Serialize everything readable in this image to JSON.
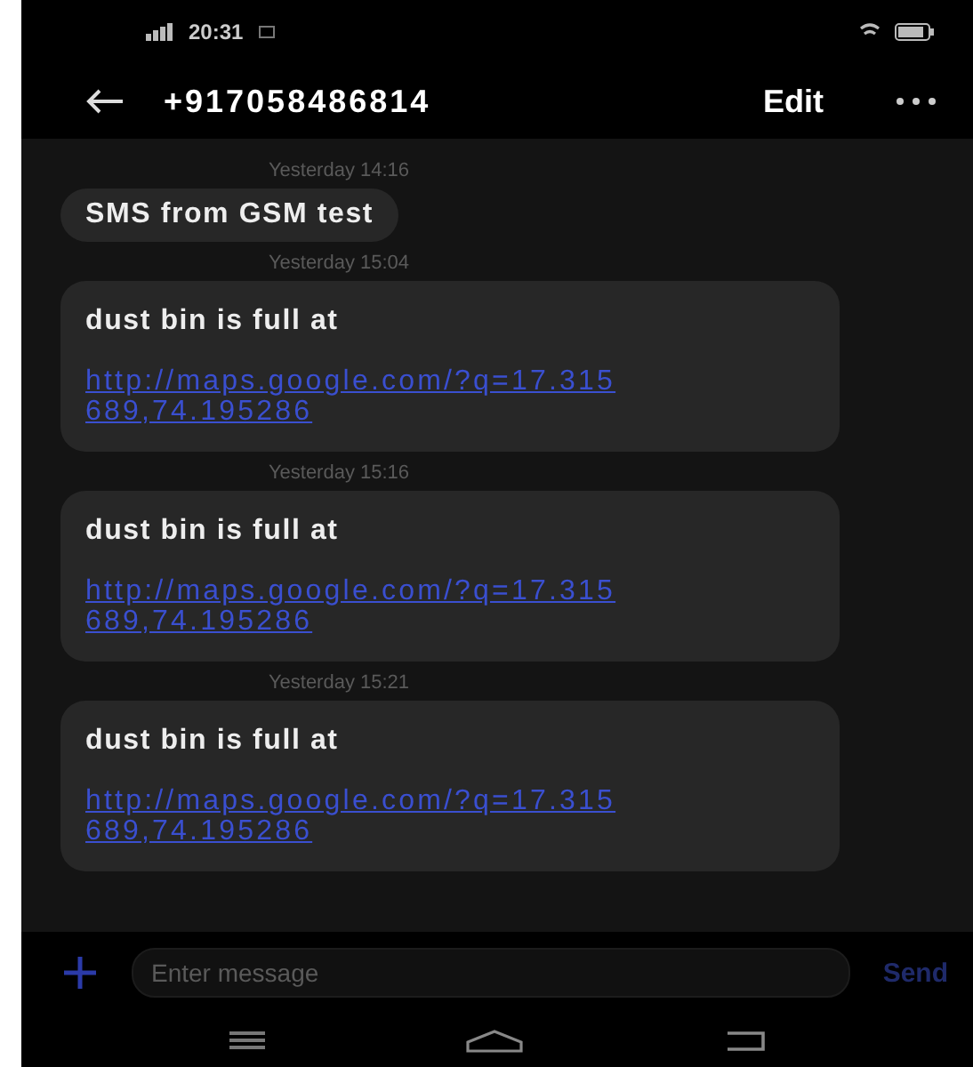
{
  "status_bar": {
    "time": "20:31"
  },
  "header": {
    "title": "+917058486814",
    "action": "Edit"
  },
  "messages": [
    {
      "timestamp": "Yesterday 14:16",
      "text": "SMS from GSM test"
    },
    {
      "timestamp": "Yesterday 15:04",
      "text": "dust bin is full at",
      "link": "http://maps.google.com/?q=17.315689,74.195286"
    },
    {
      "timestamp": "Yesterday 15:16",
      "text": "dust bin is full at",
      "link": "http://maps.google.com/?q=17.315689,74.195286"
    },
    {
      "timestamp": "Yesterday 15:21",
      "text": "dust bin is full at",
      "link": "http://maps.google.com/?q=17.315689,74.195286"
    }
  ],
  "composer": {
    "placeholder": "Enter message",
    "send": "Send"
  }
}
